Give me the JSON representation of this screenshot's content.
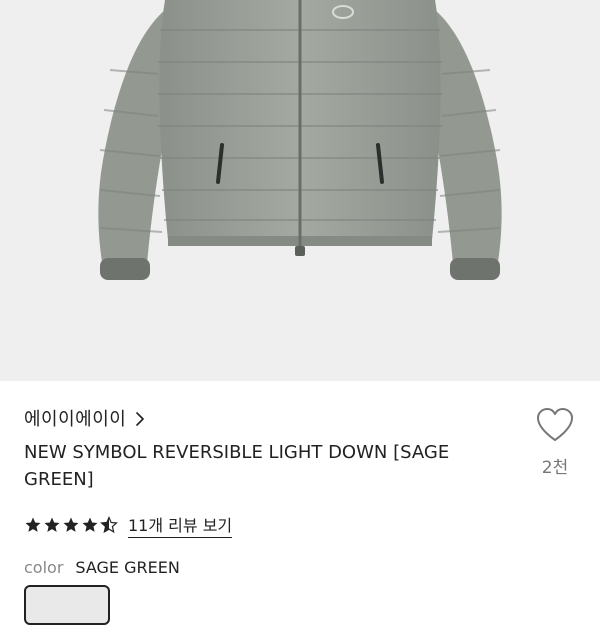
{
  "product_image": {
    "description_icon": "jacket-image"
  },
  "brand": {
    "name": "에이이에이이",
    "chevron_icon": "chevron-right-icon"
  },
  "product": {
    "title": "NEW SYMBOL REVERSIBLE LIGHT DOWN [SAGE GREEN]"
  },
  "like": {
    "icon": "heart-outline-icon",
    "count": "2천"
  },
  "rating": {
    "stars": 4.5,
    "review_link": "11개 리뷰 보기"
  },
  "color": {
    "label": "color",
    "value": "SAGE GREEN"
  },
  "colors": {
    "jacket": "#9aa098",
    "background": "#efefef",
    "text": "#222222"
  }
}
